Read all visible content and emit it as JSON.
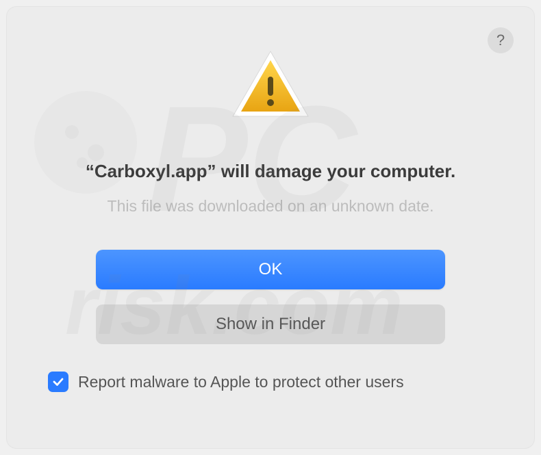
{
  "dialog": {
    "heading": "“Carboxyl.app” will damage your computer.",
    "subtext": "This file was downloaded on an unknown date.",
    "help_label": "?",
    "buttons": {
      "primary": "OK",
      "secondary": "Show in Finder"
    },
    "checkbox": {
      "checked": true,
      "label": "Report malware to Apple to protect other users"
    }
  },
  "watermark_text": "PCrisk.com"
}
